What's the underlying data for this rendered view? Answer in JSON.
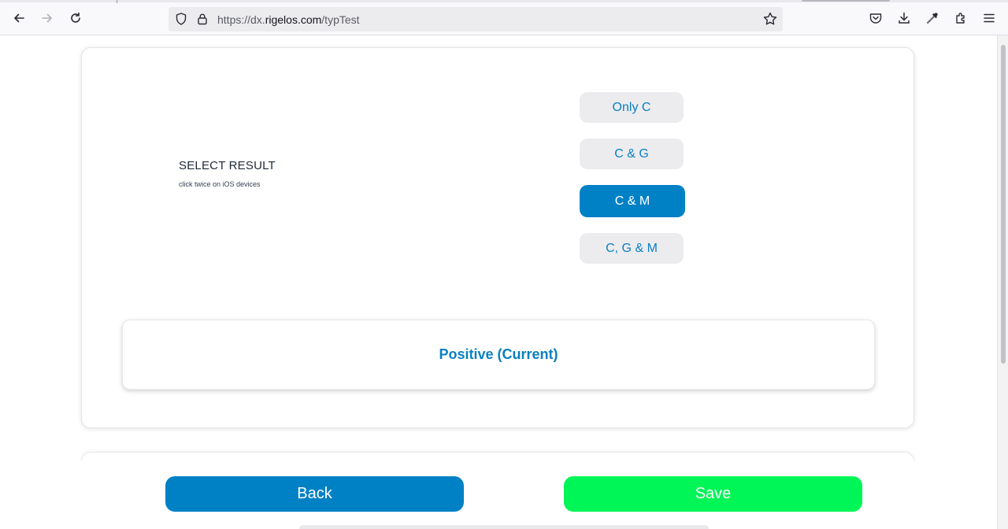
{
  "browser": {
    "url_prefix": "https://dx.",
    "url_host": "rigelos.com",
    "url_path": "/typTest"
  },
  "panel": {
    "title": "SELECT RESULT",
    "hint": "click twice on iOS devices",
    "options": [
      "Only C",
      "C & G",
      "C & M",
      "C, G & M"
    ],
    "selected_option": "C & M",
    "result": "Positive (Current)"
  },
  "footer": {
    "back_label": "Back",
    "save_label": "Save"
  },
  "colors": {
    "primary": "#0081c6",
    "save": "#00f556",
    "option_bg": "#ececef"
  }
}
